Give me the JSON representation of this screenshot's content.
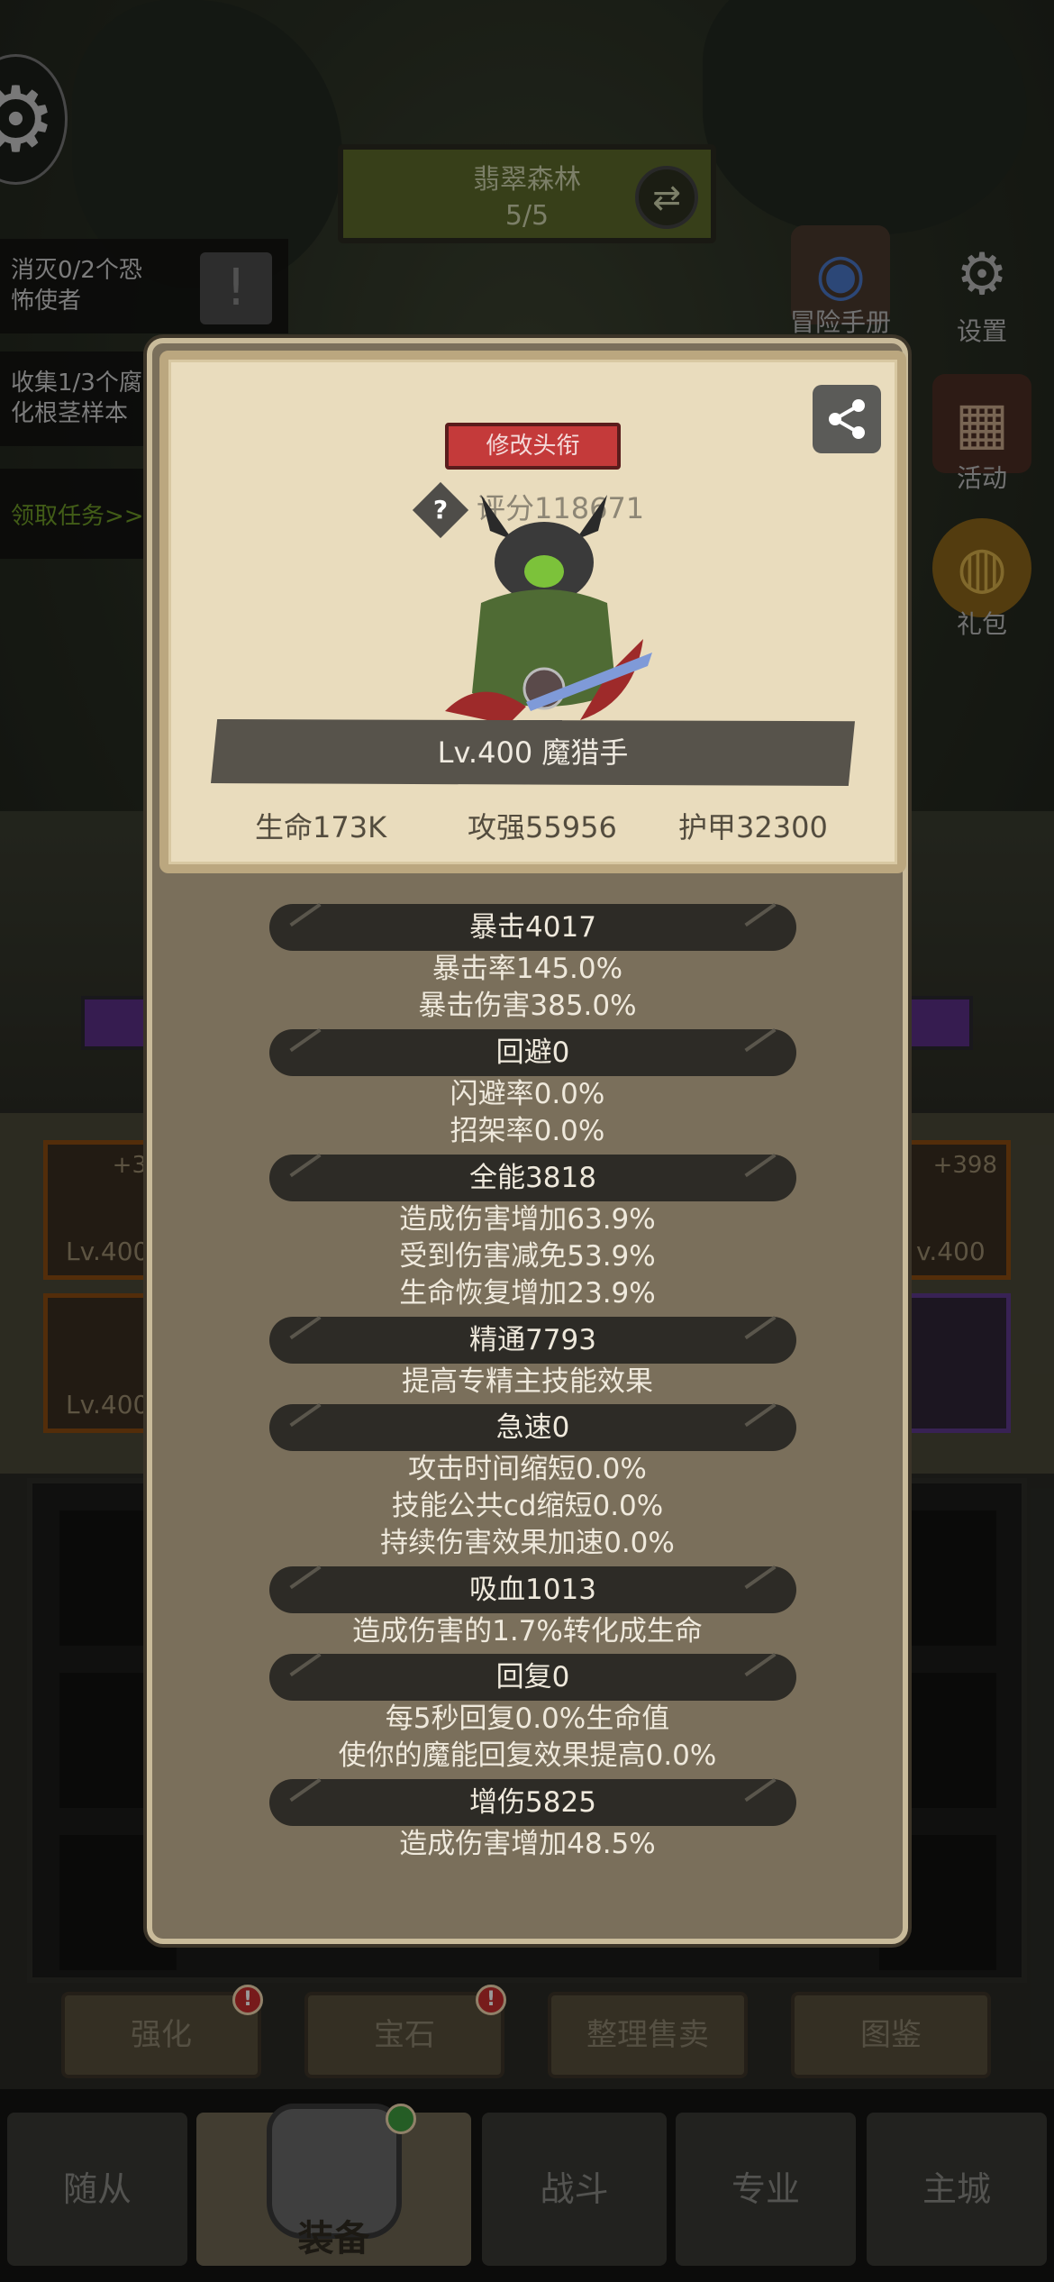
{
  "hud": {
    "level_name": "翡翠森林",
    "level_progress": "5/5",
    "quests": [
      "消灭0/2个恐\n怖使者",
      "收集1/3个腐\n化根茎样本"
    ],
    "quest_link": "领取任务>>",
    "side_buttons": [
      {
        "label": "冒险手册",
        "icon": "book-icon"
      },
      {
        "label": "设置",
        "icon": "gear-icon"
      },
      {
        "label": "活动",
        "icon": "calendar-icon"
      },
      {
        "label": "礼包",
        "icon": "pot-icon"
      }
    ]
  },
  "equipment": {
    "slots": [
      {
        "plus": "+3",
        "level": "Lv.400"
      },
      {
        "plus": "",
        "level": "Lv.400"
      },
      {
        "plus": "+398",
        "level": "v.400"
      },
      {
        "plus": "",
        "level": ""
      }
    ]
  },
  "actions": [
    {
      "label": "强化",
      "badge": "!"
    },
    {
      "label": "宝石",
      "badge": "!"
    },
    {
      "label": "整理售卖",
      "badge": ""
    },
    {
      "label": "图鉴",
      "badge": ""
    }
  ],
  "nav": {
    "tabs": [
      "随从",
      "装备",
      "战斗",
      "专业",
      "主城"
    ],
    "active_index": 1
  },
  "card": {
    "title_button": "修改头衔",
    "help_glyph": "?",
    "score": "评分118671",
    "name": "Lv.400 魔猎手",
    "stats": {
      "hp": "生命173K",
      "attack": "攻强55956",
      "armor": "护甲32300"
    }
  },
  "sections": [
    {
      "head": "暴击4017",
      "lines": [
        "暴击率145.0%",
        "暴击伤害385.0%"
      ]
    },
    {
      "head": "回避0",
      "lines": [
        "闪避率0.0%",
        "招架率0.0%"
      ]
    },
    {
      "head": "全能3818",
      "lines": [
        "造成伤害增加63.9%",
        "受到伤害减免53.9%",
        "生命恢复增加23.9%"
      ]
    },
    {
      "head": "精通7793",
      "lines": [
        "提高专精主技能效果"
      ]
    },
    {
      "head": "急速0",
      "lines": [
        "攻击时间缩短0.0%",
        "技能公共cd缩短0.0%",
        "持续伤害效果加速0.0%"
      ]
    },
    {
      "head": "吸血1013",
      "lines": [
        "造成伤害的1.7%转化成生命"
      ]
    },
    {
      "head": "回复0",
      "lines": [
        "每5秒回复0.0%生命值",
        "使你的魔能回复效果提高0.0%"
      ]
    },
    {
      "head": "增伤5825",
      "lines": [
        "造成伤害增加48.5%"
      ]
    }
  ]
}
